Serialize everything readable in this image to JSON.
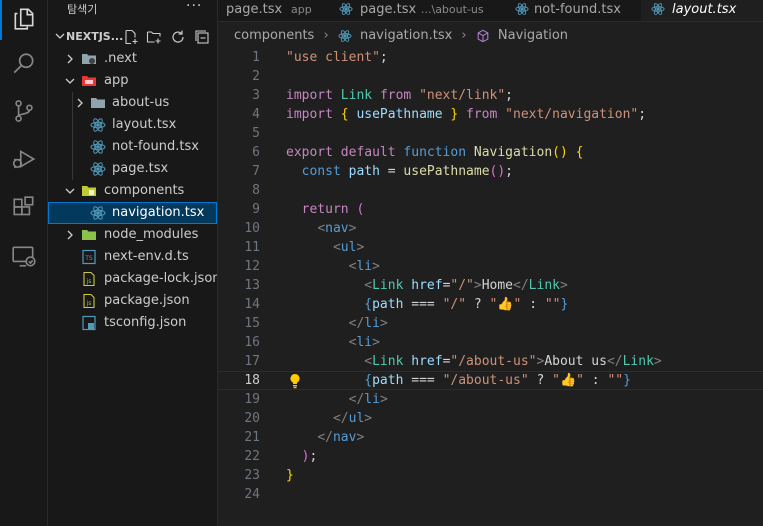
{
  "explorer": {
    "title": "탐색기",
    "more": "···",
    "folder_name": "NEXTJS...",
    "items": [
      {
        "label": ".next",
        "type": "folder"
      },
      {
        "label": "app",
        "type": "folder-open"
      },
      {
        "label": "about-us",
        "type": "folder"
      },
      {
        "label": "layout.tsx",
        "type": "react"
      },
      {
        "label": "not-found.tsx",
        "type": "react"
      },
      {
        "label": "page.tsx",
        "type": "react"
      },
      {
        "label": "components",
        "type": "folder-open"
      },
      {
        "label": "navigation.tsx",
        "type": "react"
      },
      {
        "label": "node_modules",
        "type": "folder"
      },
      {
        "label": "next-env.d.ts",
        "type": "ts"
      },
      {
        "label": "package-lock.json",
        "type": "json"
      },
      {
        "label": "package.json",
        "type": "json"
      },
      {
        "label": "tsconfig.json",
        "type": "tsconfig"
      }
    ]
  },
  "tabs": [
    {
      "label": "page.tsx",
      "desc": "app"
    },
    {
      "label": "page.tsx",
      "desc": "...\\about-us"
    },
    {
      "label": "not-found.tsx",
      "desc": ""
    },
    {
      "label": "layout.tsx",
      "desc": ""
    }
  ],
  "breadcrumb": {
    "folder": "components",
    "file": "navigation.tsx",
    "symbol": "Navigation"
  },
  "editor": {
    "current_line": 18,
    "line_numbers": [
      "1",
      "2",
      "3",
      "4",
      "5",
      "6",
      "7",
      "8",
      "9",
      "10",
      "11",
      "12",
      "13",
      "14",
      "15",
      "16",
      "17",
      "18",
      "19",
      "20",
      "21",
      "22",
      "23",
      "24"
    ],
    "lines": [
      [
        [
          "t-str",
          "\"use client\""
        ],
        [
          "t-plain",
          ";"
        ]
      ],
      [],
      [
        [
          "t-ctl",
          "import"
        ],
        [
          "t-plain",
          " "
        ],
        [
          "t-comp",
          "Link"
        ],
        [
          "t-plain",
          " "
        ],
        [
          "t-ctl",
          "from"
        ],
        [
          "t-plain",
          " "
        ],
        [
          "t-str",
          "\"next/link\""
        ],
        [
          "t-plain",
          ";"
        ]
      ],
      [
        [
          "t-ctl",
          "import"
        ],
        [
          "t-plain",
          " "
        ],
        [
          "t-p1",
          "{"
        ],
        [
          "t-plain",
          " "
        ],
        [
          "t-var",
          "usePathname"
        ],
        [
          "t-plain",
          " "
        ],
        [
          "t-p1",
          "}"
        ],
        [
          "t-plain",
          " "
        ],
        [
          "t-ctl",
          "from"
        ],
        [
          "t-plain",
          " "
        ],
        [
          "t-str",
          "\"next/navigation\""
        ],
        [
          "t-plain",
          ";"
        ]
      ],
      [],
      [
        [
          "t-ctl",
          "export"
        ],
        [
          "t-plain",
          " "
        ],
        [
          "t-ctl",
          "default"
        ],
        [
          "t-plain",
          " "
        ],
        [
          "t-kw",
          "function"
        ],
        [
          "t-plain",
          " "
        ],
        [
          "t-fn",
          "Navigation"
        ],
        [
          "t-p1",
          "()"
        ],
        [
          "t-plain",
          " "
        ],
        [
          "t-p1",
          "{"
        ]
      ],
      [
        [
          "t-plain",
          "  "
        ],
        [
          "t-kw",
          "const"
        ],
        [
          "t-plain",
          " "
        ],
        [
          "t-var",
          "path"
        ],
        [
          "t-plain",
          " = "
        ],
        [
          "t-fn",
          "usePathname"
        ],
        [
          "t-p2",
          "()"
        ],
        [
          "t-plain",
          ";"
        ]
      ],
      [],
      [
        [
          "t-plain",
          "  "
        ],
        [
          "t-ctl",
          "return"
        ],
        [
          "t-plain",
          " "
        ],
        [
          "t-p2",
          "("
        ]
      ],
      [
        [
          "t-plain",
          "    "
        ],
        [
          "t-tag",
          "<"
        ],
        [
          "t-html",
          "nav"
        ],
        [
          "t-tag",
          ">"
        ]
      ],
      [
        [
          "t-plain",
          "      "
        ],
        [
          "t-tag",
          "<"
        ],
        [
          "t-html",
          "ul"
        ],
        [
          "t-tag",
          ">"
        ]
      ],
      [
        [
          "t-plain",
          "        "
        ],
        [
          "t-tag",
          "<"
        ],
        [
          "t-html",
          "li"
        ],
        [
          "t-tag",
          ">"
        ]
      ],
      [
        [
          "t-plain",
          "          "
        ],
        [
          "t-tag",
          "<"
        ],
        [
          "t-comp",
          "Link"
        ],
        [
          "t-plain",
          " "
        ],
        [
          "t-var",
          "href"
        ],
        [
          "t-plain",
          "="
        ],
        [
          "t-str",
          "\"/\""
        ],
        [
          "t-tag",
          ">"
        ],
        [
          "t-plain",
          "Home"
        ],
        [
          "t-tag",
          "</"
        ],
        [
          "t-comp",
          "Link"
        ],
        [
          "t-tag",
          ">"
        ]
      ],
      [
        [
          "t-plain",
          "          "
        ],
        [
          "t-kw",
          "{"
        ],
        [
          "t-var",
          "path"
        ],
        [
          "t-plain",
          " === "
        ],
        [
          "t-str",
          "\"/\""
        ],
        [
          "t-plain",
          " ? "
        ],
        [
          "t-str",
          "\"👍\""
        ],
        [
          "t-plain",
          " : "
        ],
        [
          "t-str",
          "\"\""
        ],
        [
          "t-kw",
          "}"
        ]
      ],
      [
        [
          "t-plain",
          "        "
        ],
        [
          "t-tag",
          "</"
        ],
        [
          "t-html",
          "li"
        ],
        [
          "t-tag",
          ">"
        ]
      ],
      [
        [
          "t-plain",
          "        "
        ],
        [
          "t-tag",
          "<"
        ],
        [
          "t-html",
          "li"
        ],
        [
          "t-tag",
          ">"
        ]
      ],
      [
        [
          "t-plain",
          "          "
        ],
        [
          "t-tag",
          "<"
        ],
        [
          "t-comp",
          "Link"
        ],
        [
          "t-plain",
          " "
        ],
        [
          "t-var",
          "href"
        ],
        [
          "t-plain",
          "="
        ],
        [
          "t-str",
          "\"/about-us\""
        ],
        [
          "t-tag",
          ">"
        ],
        [
          "t-plain",
          "About us"
        ],
        [
          "t-tag",
          "</"
        ],
        [
          "t-comp",
          "Link"
        ],
        [
          "t-tag",
          ">"
        ]
      ],
      [
        [
          "t-plain",
          "          "
        ],
        [
          "t-kw",
          "{"
        ],
        [
          "t-var",
          "path"
        ],
        [
          "t-plain",
          " === "
        ],
        [
          "t-str",
          "\"/about-us\""
        ],
        [
          "t-plain",
          " ? "
        ],
        [
          "t-str",
          "\"👍\""
        ],
        [
          "t-plain",
          " : "
        ],
        [
          "t-str",
          "\"\""
        ],
        [
          "t-kw",
          "}"
        ]
      ],
      [
        [
          "t-plain",
          "        "
        ],
        [
          "t-tag",
          "</"
        ],
        [
          "t-html",
          "li"
        ],
        [
          "t-tag",
          ">"
        ]
      ],
      [
        [
          "t-plain",
          "      "
        ],
        [
          "t-tag",
          "</"
        ],
        [
          "t-html",
          "ul"
        ],
        [
          "t-tag",
          ">"
        ]
      ],
      [
        [
          "t-plain",
          "    "
        ],
        [
          "t-tag",
          "</"
        ],
        [
          "t-html",
          "nav"
        ],
        [
          "t-tag",
          ">"
        ]
      ],
      [
        [
          "t-plain",
          "  "
        ],
        [
          "t-p2",
          ")"
        ],
        [
          "t-plain",
          ";"
        ]
      ],
      [
        [
          "t-p1",
          "}"
        ]
      ],
      []
    ]
  },
  "colors": {
    "accent": "#0078d4",
    "selection": "#04395e",
    "react_icon": "#519aba",
    "ts_icon": "#519aba",
    "json_icon": "#cbcb41"
  }
}
